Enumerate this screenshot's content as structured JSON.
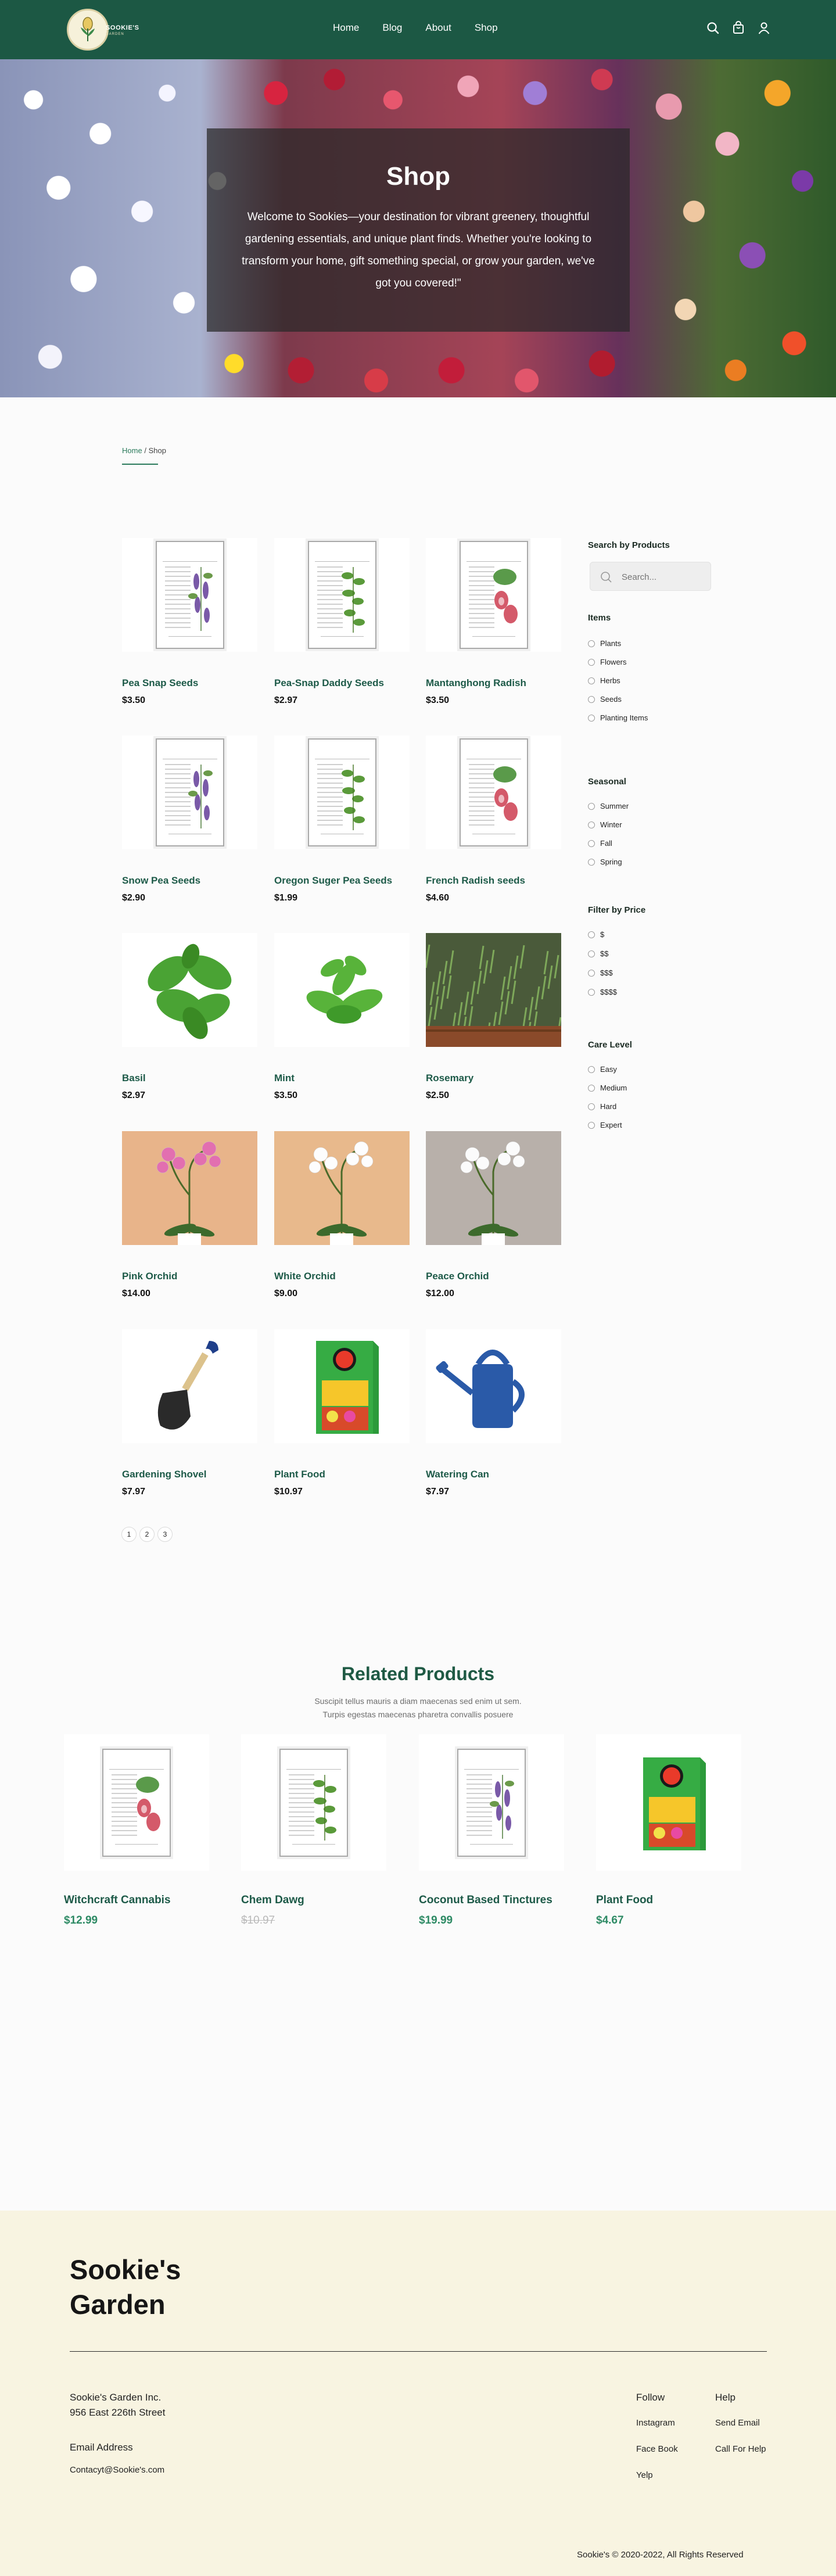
{
  "header": {
    "brand": "SOOKIE'S",
    "brand_sub": "GARDEN",
    "nav": [
      "Home",
      "Blog",
      "About",
      "Shop"
    ],
    "icons": [
      "search-icon",
      "cart-icon",
      "user-icon"
    ]
  },
  "hero": {
    "title": "Shop",
    "text": "Welcome to Sookies—your destination for vibrant greenery, thoughtful gardening essentials, and unique plant finds. Whether you're looking to transform your home, gift something special, or grow your garden, we've got you covered!\""
  },
  "breadcrumb": {
    "home": "Home",
    "sep": "/",
    "current": "Shop"
  },
  "products": [
    {
      "name": "Pea Snap Seeds",
      "price": "$3.50",
      "image": "seed-packet"
    },
    {
      "name": "Pea-Snap Daddy Seeds",
      "price": "$2.97",
      "image": "seed-packet"
    },
    {
      "name": "Mantanghong Radish",
      "price": "$3.50",
      "image": "seed-packet"
    },
    {
      "name": "Snow Pea Seeds",
      "price": "$2.90",
      "image": "seed-packet"
    },
    {
      "name": "Oregon Suger Pea Seeds",
      "price": "$1.99",
      "image": "seed-packet"
    },
    {
      "name": "French Radish seeds",
      "price": "$4.60",
      "image": "seed-packet"
    },
    {
      "name": "Basil",
      "price": "$2.97",
      "image": "basil"
    },
    {
      "name": "Mint",
      "price": "$3.50",
      "image": "mint"
    },
    {
      "name": "Rosemary",
      "price": "$2.50",
      "image": "rosemary"
    },
    {
      "name": "Pink Orchid",
      "price": "$14.00",
      "image": "orchid"
    },
    {
      "name": "White Orchid",
      "price": "$9.00",
      "image": "orchid"
    },
    {
      "name": "Peace  Orchid",
      "price": "$12.00",
      "image": "orchid"
    },
    {
      "name": "Gardening Shovel",
      "price": "$7.97",
      "image": "shovel"
    },
    {
      "name": "Plant Food",
      "price": "$10.97",
      "image": "plant-food"
    },
    {
      "name": "Watering Can",
      "price": "$7.97",
      "image": "watering-can"
    }
  ],
  "pagination": [
    "1",
    "2",
    "3"
  ],
  "sidebar": {
    "search_heading": "Search by Products",
    "search_placeholder": "Search...",
    "items_heading": "Items",
    "items": [
      "Plants",
      "Flowers",
      "Herbs",
      "Seeds",
      "Planting Items"
    ],
    "seasonal_heading": "Seasonal",
    "seasonal": [
      "Summer",
      "Winter",
      "Fall",
      "Spring"
    ],
    "price_heading": "Filter by Price",
    "price": [
      "$",
      "$$",
      "$$$",
      "$$$$"
    ],
    "care_heading": "Care Level",
    "care": [
      "Easy",
      "Medium",
      "Hard",
      "Expert"
    ]
  },
  "related": {
    "title": "Related Products",
    "subtitle_1": "Suscipit tellus mauris a diam maecenas sed enim ut sem.",
    "subtitle_2": "Turpis egestas maecenas pharetra convallis posuere",
    "items": [
      {
        "name": "Witchcraft Cannabis",
        "price": "$12.99"
      },
      {
        "name": "Chem Dawg",
        "price": "$10.97"
      },
      {
        "name": "Coconut Based Tinctures",
        "price": "$19.99"
      },
      {
        "name": "Plant Food",
        "price": "$4.67"
      }
    ]
  },
  "footer": {
    "title": "Sookie's Garden",
    "company": "Sookie's Garden Inc.",
    "address": "956 East 226th Street",
    "email_label": "Email Address",
    "email": "Contacyt@Sookie's.com",
    "follow_heading": "Follow",
    "follow": [
      "Instagram",
      "Face Book",
      "Yelp"
    ],
    "help_heading": "Help",
    "help": [
      "Send Email",
      "Call For Help"
    ],
    "copyright": "Sookie's © 2020-2022, All Rights Reserved"
  },
  "colors": {
    "brand_green": "#1c5844",
    "accent_green": "#2d8a64",
    "footer_bg": "#f8f4e1"
  }
}
